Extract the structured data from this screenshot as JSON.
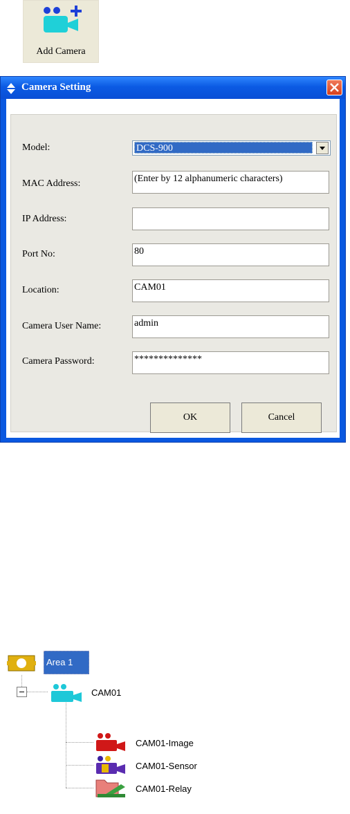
{
  "toolbar": {
    "add_camera_label": "Add Camera",
    "add_camera_icon": "camera-add-icon"
  },
  "dialog": {
    "title": "Camera Setting",
    "fields": {
      "model": {
        "label": "Model:",
        "value": "DCS-900"
      },
      "mac": {
        "label": "MAC Address:",
        "value": "(Enter by 12 alphanumeric characters)"
      },
      "ip": {
        "label": "IP Address:",
        "value": ""
      },
      "port": {
        "label": "Port No:",
        "value": "80"
      },
      "location": {
        "label": "Location:",
        "value": "CAM01"
      },
      "user": {
        "label": "Camera User Name:",
        "value": "admin"
      },
      "password": {
        "label": "Camera Password:",
        "value": "**************"
      }
    },
    "ok_label": "OK",
    "cancel_label": "Cancel"
  },
  "tree": {
    "area": "Area 1",
    "camera": "CAM01",
    "children": [
      "CAM01-Image",
      "CAM01-Sensor",
      "CAM01-Relay"
    ]
  },
  "colors": {
    "titlebar": "#0a58e0",
    "selection": "#316ac5",
    "panel": "#eae9e3"
  }
}
